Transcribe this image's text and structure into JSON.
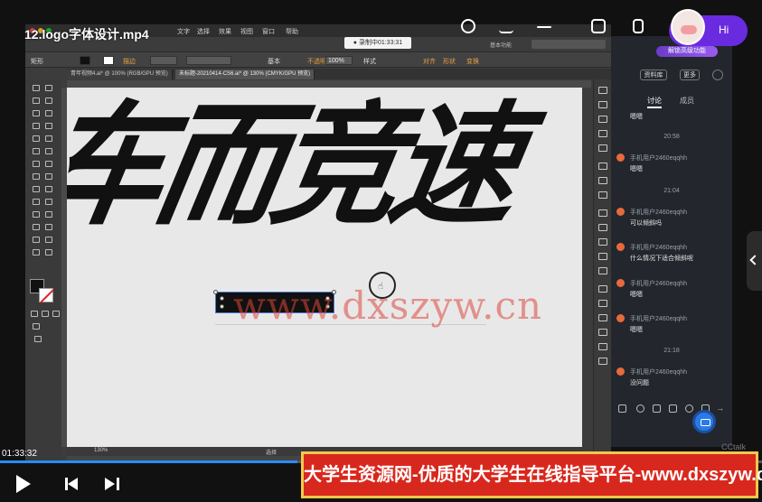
{
  "video": {
    "title": "12.logo字体设计.mp4",
    "current_time": "01:33:32",
    "progress_fraction": 0.39,
    "greeting": "Hi",
    "promo_text": "大学生资源网-优质的大学生在线指导平台-www.dxszyw.cn",
    "watermark": "www.dxszyw.cn",
    "brand_corner": "CCtalk"
  },
  "illustrator": {
    "menu": [
      "文字",
      "选择",
      "效果",
      "视图",
      "窗口",
      "帮助"
    ],
    "recording": "● 录制中01:33:31",
    "workspace": "基本功能",
    "control": {
      "shape_label": "矩形",
      "stroke_label": "描边",
      "style_basic": "基本",
      "opacity_label": "不透明度",
      "opacity_value": "100%",
      "style_label": "样式",
      "align_label": "对齐",
      "shape_opt": "形状",
      "transform_label": "变换"
    },
    "tabs": [
      "青年视频4.ai* @ 100% (RGB/GPU 预览)",
      "未标题-20210414-CS6.ai* @ 130% (CMYK/GPU 预览)"
    ],
    "artboard_text": "车而竞速",
    "status_zoom": "130%",
    "status_tool": "选择"
  },
  "chat": {
    "banner": "解锁高级功能",
    "pill_1": "资料库",
    "pill_2": "更多",
    "tab_discussion": "讨论",
    "tab_members": "成员",
    "top_partial": "嗯嗯",
    "messages": [
      {
        "time": "20:58",
        "user": "手机用户2460eqqhh",
        "text": "嗯嗯"
      },
      {
        "time": "21:04",
        "user": "手机用户2460eqqhh",
        "text": "可以倾斜吗"
      },
      {
        "time": "",
        "user": "手机用户2460eqqhh",
        "text": "什么情况下适合倾斜呢"
      },
      {
        "time": "",
        "user": "手机用户2460eqqhh",
        "text": "嗯嗯"
      },
      {
        "time": "",
        "user": "手机用户2460eqqhh",
        "text": "嗯嗯"
      },
      {
        "time": "21:18",
        "user": "手机用户2460eqqhh",
        "text": "没问题"
      }
    ]
  },
  "colors": {
    "accent_blue": "#2a8cff",
    "promo_red": "#d8281e",
    "promo_border": "#f5c74a",
    "chat_bg": "#23272d",
    "hi_purple": "#6a2be0"
  }
}
